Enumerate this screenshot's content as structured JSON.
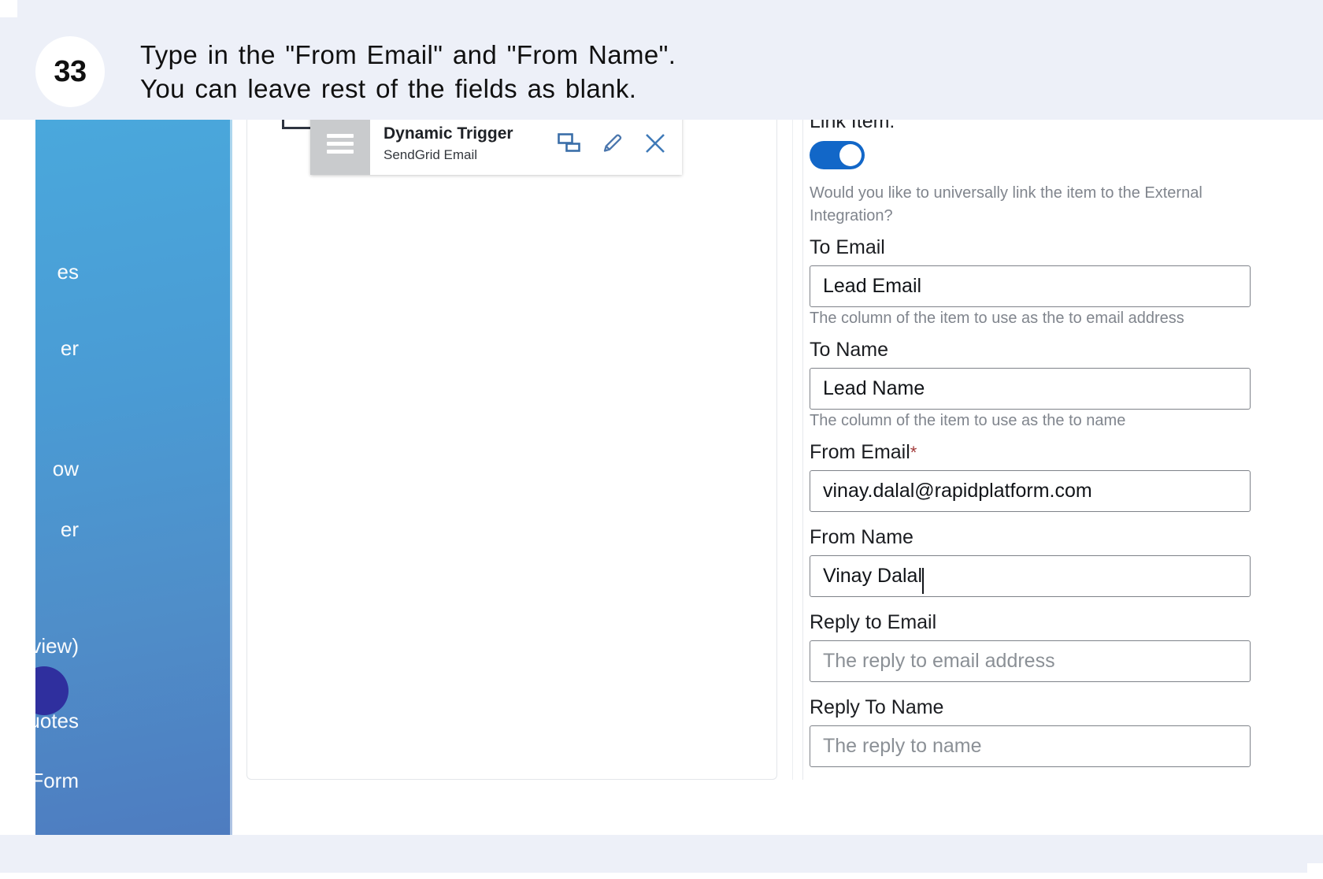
{
  "instruction": {
    "step_number": "33",
    "line1": "Type in the \"From Email\" and \"From Name\".",
    "line2": "You can leave rest of the fields as blank."
  },
  "sidebar": {
    "items": [
      {
        "label": "es"
      },
      {
        "label": "er"
      },
      {
        "label": "ow"
      },
      {
        "label": "er"
      },
      {
        "label": "(Preview)"
      },
      {
        "label": "uotes"
      },
      {
        "label": "Form"
      }
    ]
  },
  "canvas": {
    "node": {
      "title": "Dynamic Trigger",
      "subtitle": "SendGrid Email",
      "icon": "hamburger-icon",
      "actions": [
        {
          "name": "duplicate-icon",
          "label": "Duplicate"
        },
        {
          "name": "edit-pencil-icon",
          "label": "Edit"
        },
        {
          "name": "close-x-icon",
          "label": "Remove"
        }
      ]
    },
    "click_indicator": {
      "color": "#f8d2a6",
      "border_color": "#e29340"
    }
  },
  "properties": {
    "link_item": {
      "label": "Link Item:",
      "toggle_on": true,
      "toggle_color": "#1267c8",
      "help": "Would you like to universally link the item to the External Integration?"
    },
    "fields": [
      {
        "label": "To Email",
        "value": "Lead Email",
        "placeholder": "",
        "help": "The column of the item to use as the to email address",
        "required": false
      },
      {
        "label": "To Name",
        "value": "Lead Name",
        "placeholder": "",
        "help": "The column of the item to use as the to name",
        "required": false
      },
      {
        "label": "From Email",
        "value": "vinay.dalal@rapidplatform.com",
        "placeholder": "",
        "help": "",
        "required": true,
        "required_marker": "*"
      },
      {
        "label": "From Name",
        "value": "Vinay Dalal",
        "placeholder": "",
        "help": "",
        "required": false,
        "focused": true
      },
      {
        "label": "Reply to Email",
        "value": "",
        "placeholder": "The reply to email address",
        "help": "",
        "required": false
      },
      {
        "label": "Reply To Name",
        "value": "",
        "placeholder": "The reply to name",
        "help": "",
        "required": false
      }
    ]
  }
}
